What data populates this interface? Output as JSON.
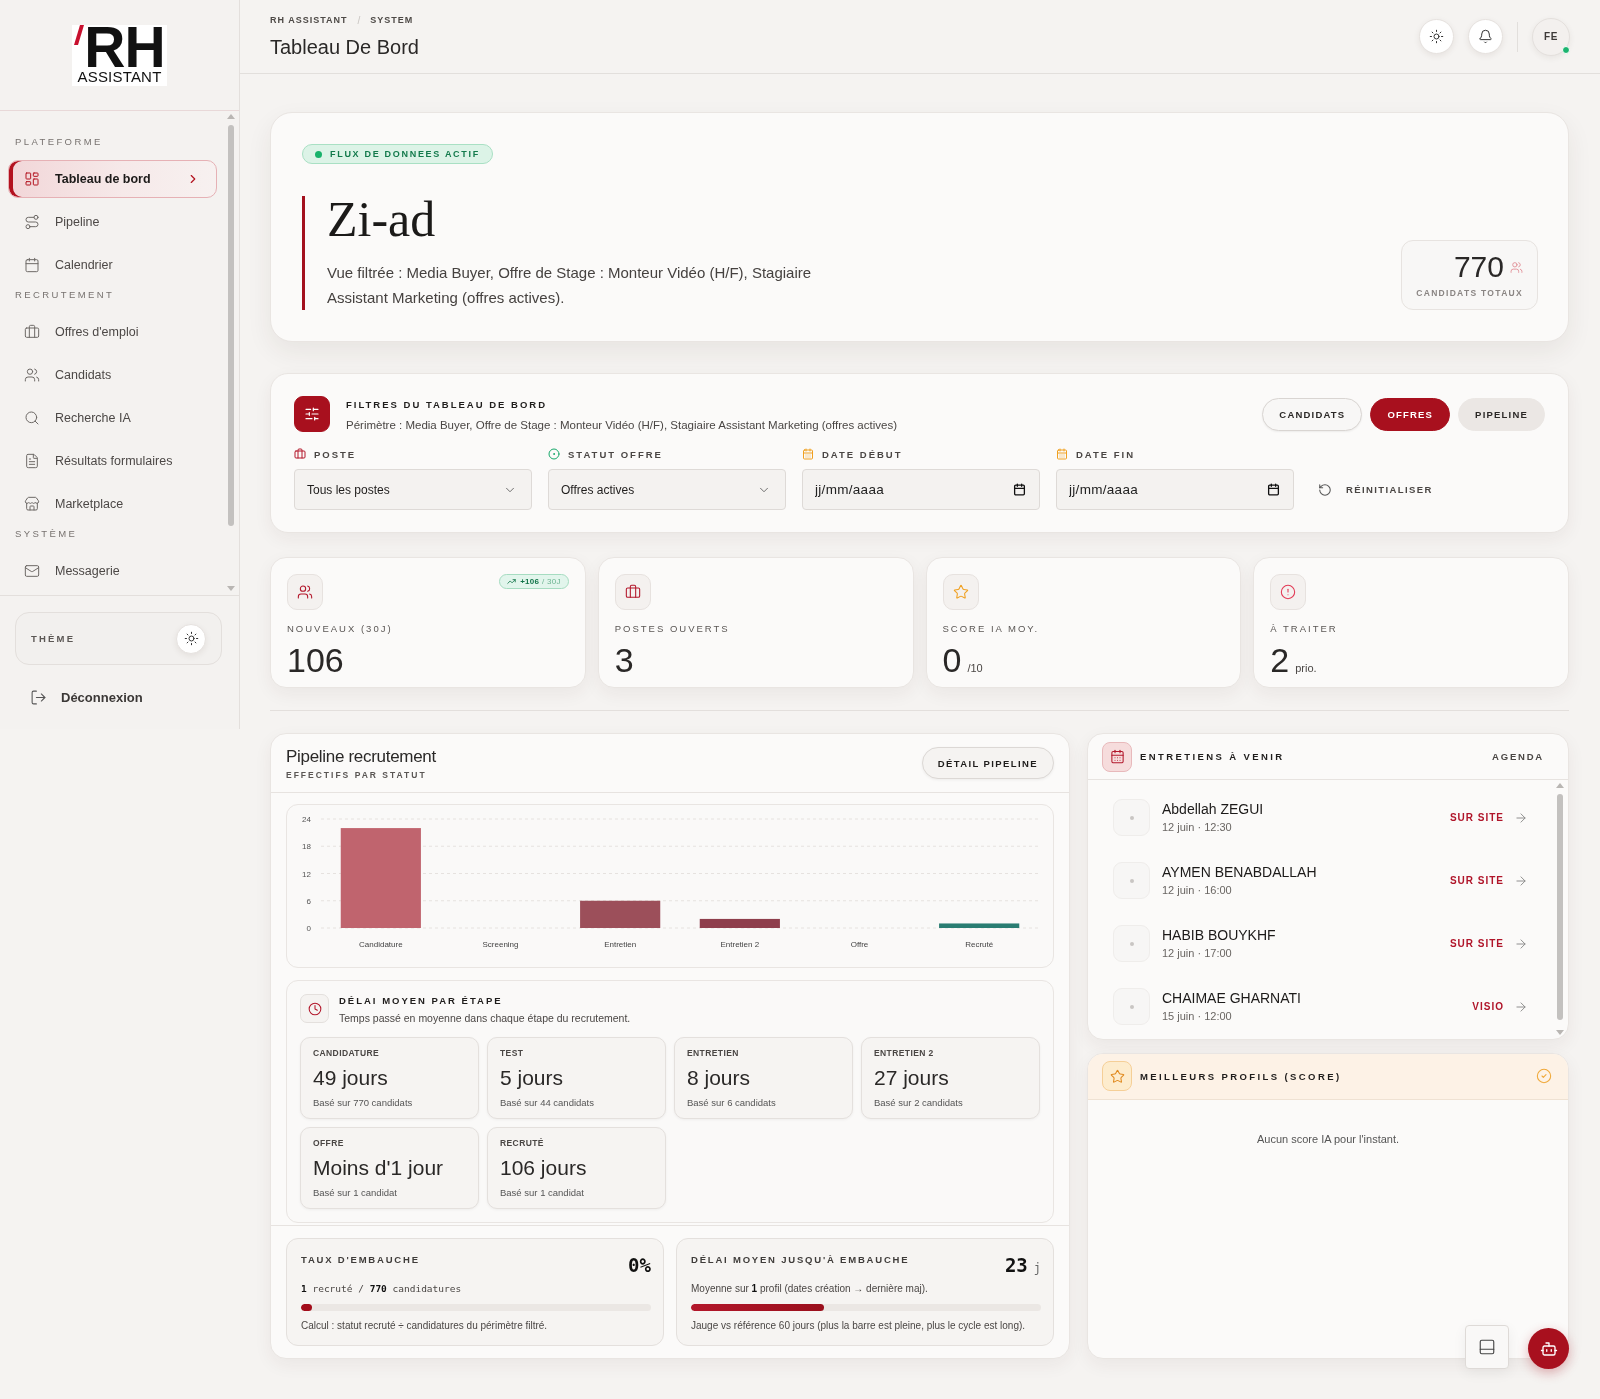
{
  "sidebar": {
    "logo": {
      "mark": "RH",
      "wordmark": "ASSISTANT"
    },
    "sections": [
      {
        "title": "PLATEFORME",
        "items": [
          {
            "label": "Tableau de bord",
            "selected": true
          },
          {
            "label": "Pipeline",
            "selected": false
          },
          {
            "label": "Calendrier",
            "selected": false
          }
        ]
      },
      {
        "title": "RECRUTEMENT",
        "items": [
          {
            "label": "Offres d'emploi",
            "selected": false
          },
          {
            "label": "Candidats",
            "selected": false
          },
          {
            "label": "Recherche IA",
            "selected": false
          },
          {
            "label": "Résultats formulaires",
            "selected": false
          },
          {
            "label": "Marketplace",
            "selected": false
          }
        ]
      },
      {
        "title": "SYSTÈME",
        "items": [
          {
            "label": "Messagerie",
            "selected": false
          }
        ]
      }
    ],
    "theme_label": "THÈME",
    "logout": "Déconnexion"
  },
  "header": {
    "breadcrumb": [
      "RH ASSISTANT",
      "SYSTEM"
    ],
    "separator": "/",
    "title": "Tableau De Bord",
    "user": {
      "initials": "FE",
      "online": true
    }
  },
  "hero": {
    "badge": {
      "label": "FLUX DE DONNEES ACTIF",
      "live": true
    },
    "title": "Zi-ad",
    "description": "Vue filtrée : Media Buyer, Offre de Stage : Monteur Vidéo (H/F), Stagiaire Assistant Marketing (offres actives).",
    "stat": {
      "value": "770",
      "label": "CANDIDATS TOTAUX"
    }
  },
  "filters": {
    "title": "FILTRES DU TABLEAU DE BORD",
    "scope": "Périmètre : Media Buyer, Offre de Stage : Monteur Vidéo (H/F), Stagiaire Assistant Marketing (offres actives)",
    "tabs": [
      {
        "label": "CANDIDATS",
        "kind": "outline",
        "selected": false
      },
      {
        "label": "OFFRES",
        "kind": "outline",
        "selected": true
      },
      {
        "label": "PIPELINE",
        "kind": "soft",
        "selected": false
      }
    ],
    "fields": [
      {
        "kind": "select",
        "label": "POSTE",
        "value": "Tous les postes"
      },
      {
        "kind": "select",
        "label": "STATUT OFFRE",
        "value": "Offres actives"
      },
      {
        "kind": "date",
        "label": "DATE DÉBUT",
        "placeholder": "jj/mm/aaaa"
      },
      {
        "kind": "date",
        "label": "DATE FIN",
        "placeholder": "jj/mm/aaaa"
      }
    ],
    "reset": "RÉINITIALISER"
  },
  "kpis": [
    {
      "label": "NOUVEAUX (30J)",
      "value": "106",
      "trend": "**+106** / 30J"
    },
    {
      "label": "POSTES OUVERTS",
      "value": "3"
    },
    {
      "label": "SCORE IA MOY.",
      "value": "0",
      "unit": "/10"
    },
    {
      "label": "À TRAITER",
      "value": "2",
      "unit": "prio."
    }
  ],
  "pipeline": {
    "title": "Pipeline recrutement",
    "subtitle": "EFFECTIFS PAR STATUT",
    "action": "DÉTAIL PIPELINE",
    "chart_data": {
      "type": "bar",
      "categories": [
        "Candidature",
        "Screening",
        "Entretien",
        "Entretien 2",
        "Offre",
        "Recruté"
      ],
      "values": [
        22,
        0,
        6,
        2,
        0,
        1
      ],
      "colors": [
        "#c0646e",
        null,
        "#9c4f5a",
        "#8e3e4c",
        null,
        "#2a7d72"
      ],
      "ylim": [
        0,
        24
      ],
      "yticks": [
        0,
        6,
        12,
        18,
        24
      ],
      "grid": true
    },
    "delays": {
      "title": "DÉLAI MOYEN PAR ÉTAPE",
      "subtitle": "Temps passé en moyenne dans chaque étape du recrutement.",
      "stages": [
        {
          "label": "CANDIDATURE",
          "value": "49 jours",
          "basis": "Basé sur 770 candidats"
        },
        {
          "label": "TEST",
          "value": "5 jours",
          "basis": "Basé sur 44 candidats"
        },
        {
          "label": "ENTRETIEN",
          "value": "8 jours",
          "basis": "Basé sur 6 candidats"
        },
        {
          "label": "ENTRETIEN 2",
          "value": "27 jours",
          "basis": "Basé sur 2 candidats"
        },
        {
          "label": "OFFRE",
          "value": "Moins d'1 jour",
          "basis": "Basé sur 1 candidat"
        },
        {
          "label": "RECRUTÉ",
          "value": "106 jours",
          "basis": "Basé sur 1 candidat"
        }
      ]
    },
    "metrics": [
      {
        "kind": "ratio",
        "title": "TAUX D'EMBAUCHE",
        "value": "0%",
        "detail": "**1** recruté / **770** candidatures",
        "level": 0.03,
        "note": "Calcul : statut recruté ÷ candidatures du périmètre filtré."
      },
      {
        "kind": "duration",
        "title": "DÉLAI MOYEN JUSQU'À EMBAUCHE",
        "value": "23",
        "unit": "j",
        "detail": "Moyenne sur **1** profil (dates création → dernière maj).",
        "level": 0.38,
        "note": "Jauge vs référence 60 jours (plus la barre est pleine, plus le cycle est long)."
      }
    ]
  },
  "interviews": {
    "title": "ENTRETIENS À VENIR",
    "action": "AGENDA",
    "items": [
      {
        "name": "Abdellah ZEGUI",
        "time": "12 juin · 12:30",
        "mode": "SUR SITE"
      },
      {
        "name": "AYMEN BENABDALLAH",
        "time": "12 juin · 16:00",
        "mode": "SUR SITE"
      },
      {
        "name": "HABIB BOUYKHF",
        "time": "12 juin · 17:00",
        "mode": "SUR SITE"
      },
      {
        "name": "CHAIMAE GHARNATI",
        "time": "15 juin · 12:00",
        "mode": "VISIO"
      }
    ]
  },
  "top_profiles": {
    "title": "MEILLEURS PROFILS (SCORE)",
    "empty": "Aucun score IA pour l'instant."
  }
}
